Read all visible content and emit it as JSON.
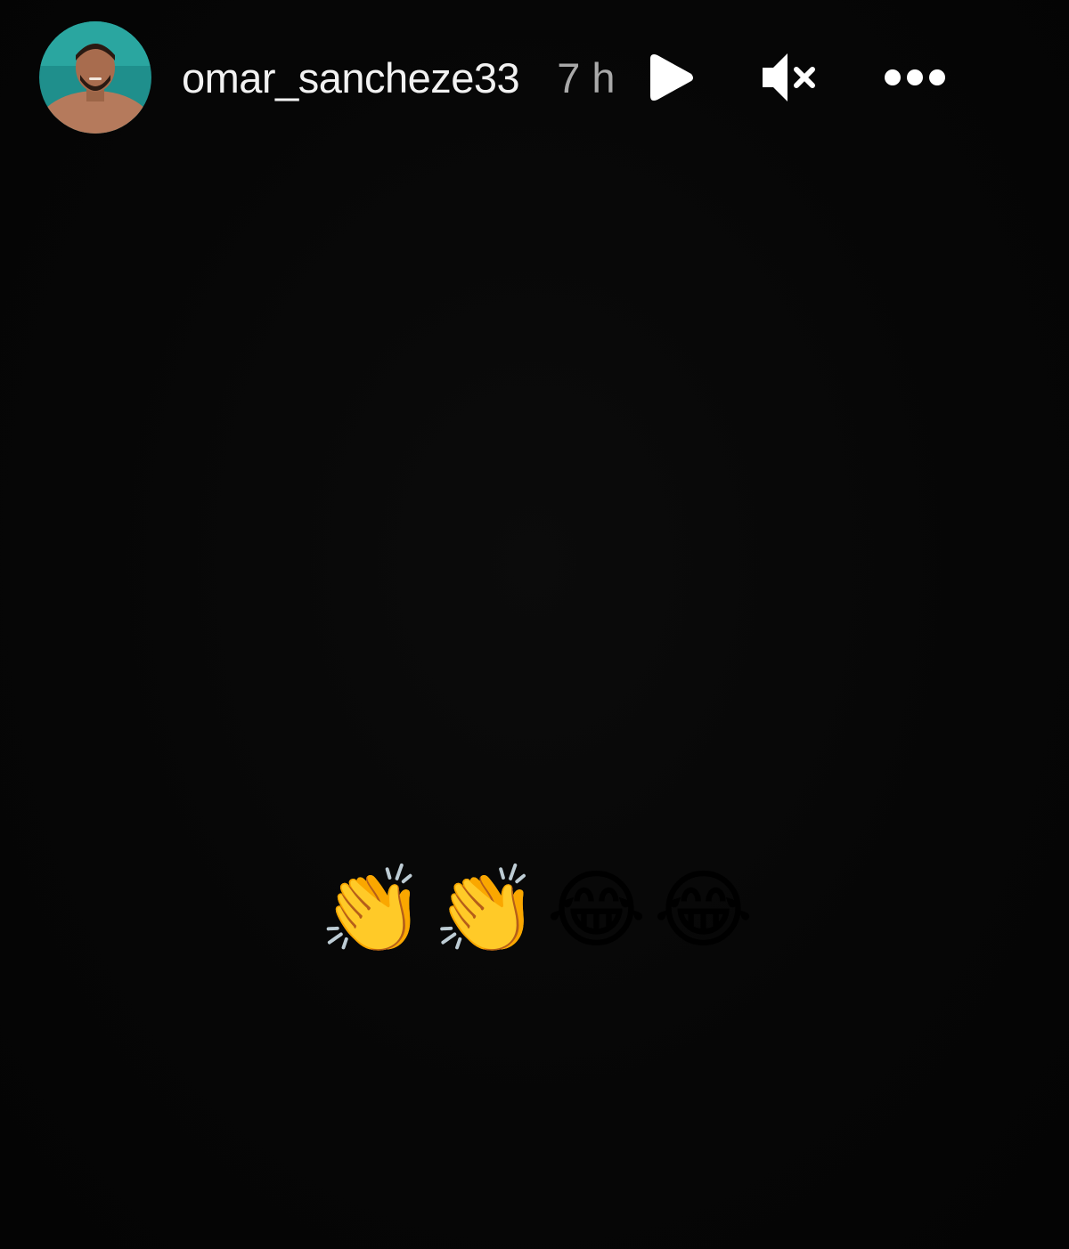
{
  "story": {
    "username": "omar_sancheze33",
    "time_ago": "7 h",
    "caption": "👏👏😂😂"
  },
  "icons": {
    "play": "play-icon",
    "mute": "speaker-muted-icon",
    "more": "more-options-icon"
  },
  "colors": {
    "background": "#050505",
    "username": "#f2f2f2",
    "time": "#a9a9a9",
    "icon": "#ffffff"
  }
}
